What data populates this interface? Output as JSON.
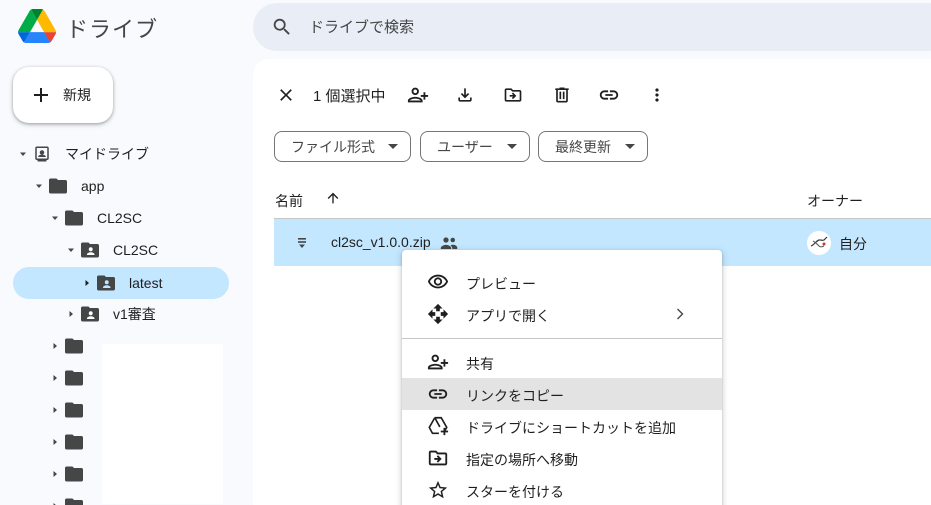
{
  "app": {
    "title": "ドライブ"
  },
  "search": {
    "placeholder": "ドライブで検索"
  },
  "new_button": {
    "label": "新規"
  },
  "tree": {
    "my_drive": "マイドライブ",
    "items": [
      {
        "label": "app"
      },
      {
        "label": "CL2SC"
      },
      {
        "label": "CL2SC"
      },
      {
        "label": "latest"
      },
      {
        "label": "v1審査"
      }
    ]
  },
  "toolbar": {
    "selection_count": "1 個選択中"
  },
  "filters": [
    {
      "label": "ファイル形式"
    },
    {
      "label": "ユーザー"
    },
    {
      "label": "最終更新"
    }
  ],
  "table": {
    "headers": {
      "name": "名前",
      "owner": "オーナー"
    },
    "rows": [
      {
        "name": "cl2sc_v1.0.0.zip",
        "owner": "自分"
      }
    ]
  },
  "context_menu": {
    "items": [
      {
        "label": "プレビュー",
        "icon": "eye-icon"
      },
      {
        "label": "アプリで開く",
        "icon": "open-with-icon"
      },
      {
        "label": "共有",
        "icon": "person-add-icon"
      },
      {
        "label": "リンクをコピー",
        "icon": "link-icon"
      },
      {
        "label": "ドライブにショートカットを追加",
        "icon": "add-to-drive-icon"
      },
      {
        "label": "指定の場所へ移動",
        "icon": "move-icon"
      },
      {
        "label": "スターを付ける",
        "icon": "star-icon"
      }
    ]
  },
  "colors": {
    "accent": "#c2e7ff",
    "background": "#f8fafd",
    "search_bg": "#e9eef6",
    "hover": "#e3e3e3"
  }
}
